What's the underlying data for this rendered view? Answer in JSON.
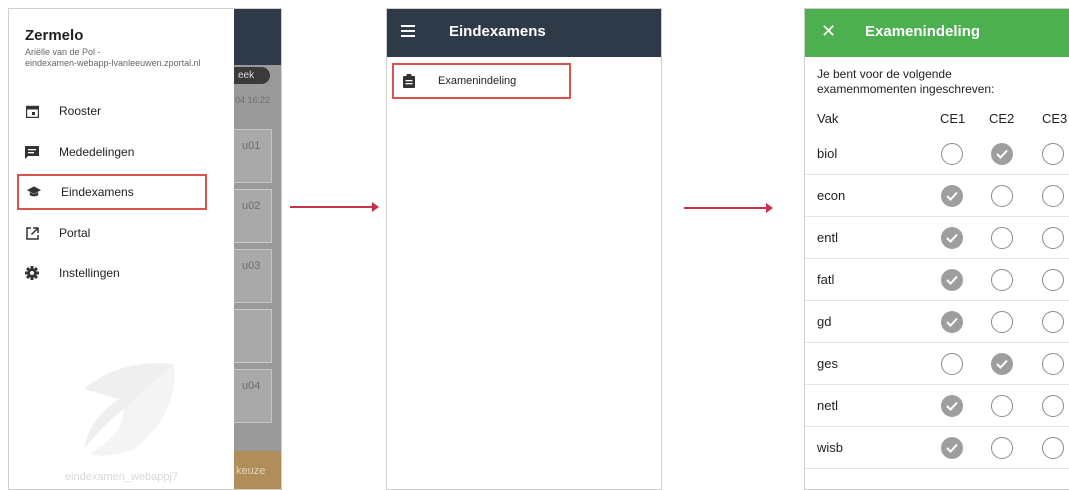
{
  "drawer": {
    "app_title": "Zermelo",
    "user_line1": "Ariëlle van de Pol -",
    "user_line2": "eindexamen-webapp-lvanleeuwen.zportal.nl",
    "items": [
      {
        "label": "Rooster",
        "icon": "calendar-icon"
      },
      {
        "label": "Mededelingen",
        "icon": "message-icon"
      },
      {
        "label": "Eindexamens",
        "icon": "graduation-cap-icon"
      },
      {
        "label": "Portal",
        "icon": "external-link-icon"
      },
      {
        "label": "Instellingen",
        "icon": "gear-icon"
      }
    ],
    "watermark_text": "eindexamen_webappj7"
  },
  "background_app": {
    "week_pill": "eek",
    "date": "04 16:22",
    "cards": [
      "u01",
      "u02",
      "u03",
      "",
      "u04"
    ],
    "footer": "keuze"
  },
  "eindexamens_screen": {
    "title": "Eindexamens",
    "item_label": "Examenindeling"
  },
  "examenindeling_screen": {
    "title": "Examenindeling",
    "intro_line1": "Je bent voor de volgende",
    "intro_line2": "examenmomenten ingeschreven:",
    "columns": [
      "Vak",
      "CE1",
      "CE2",
      "CE3"
    ],
    "rows": [
      {
        "vak": "biol",
        "selected": "CE2"
      },
      {
        "vak": "econ",
        "selected": "CE1"
      },
      {
        "vak": "entl",
        "selected": "CE1"
      },
      {
        "vak": "fatl",
        "selected": "CE1"
      },
      {
        "vak": "gd",
        "selected": "CE1"
      },
      {
        "vak": "ges",
        "selected": "CE2"
      },
      {
        "vak": "netl",
        "selected": "CE1"
      },
      {
        "vak": "wisb",
        "selected": "CE1"
      }
    ]
  },
  "colors": {
    "dark_header": "#2e3a48",
    "green_header": "#4caf50",
    "highlight": "#d9534f",
    "arrow": "#c8304b"
  }
}
